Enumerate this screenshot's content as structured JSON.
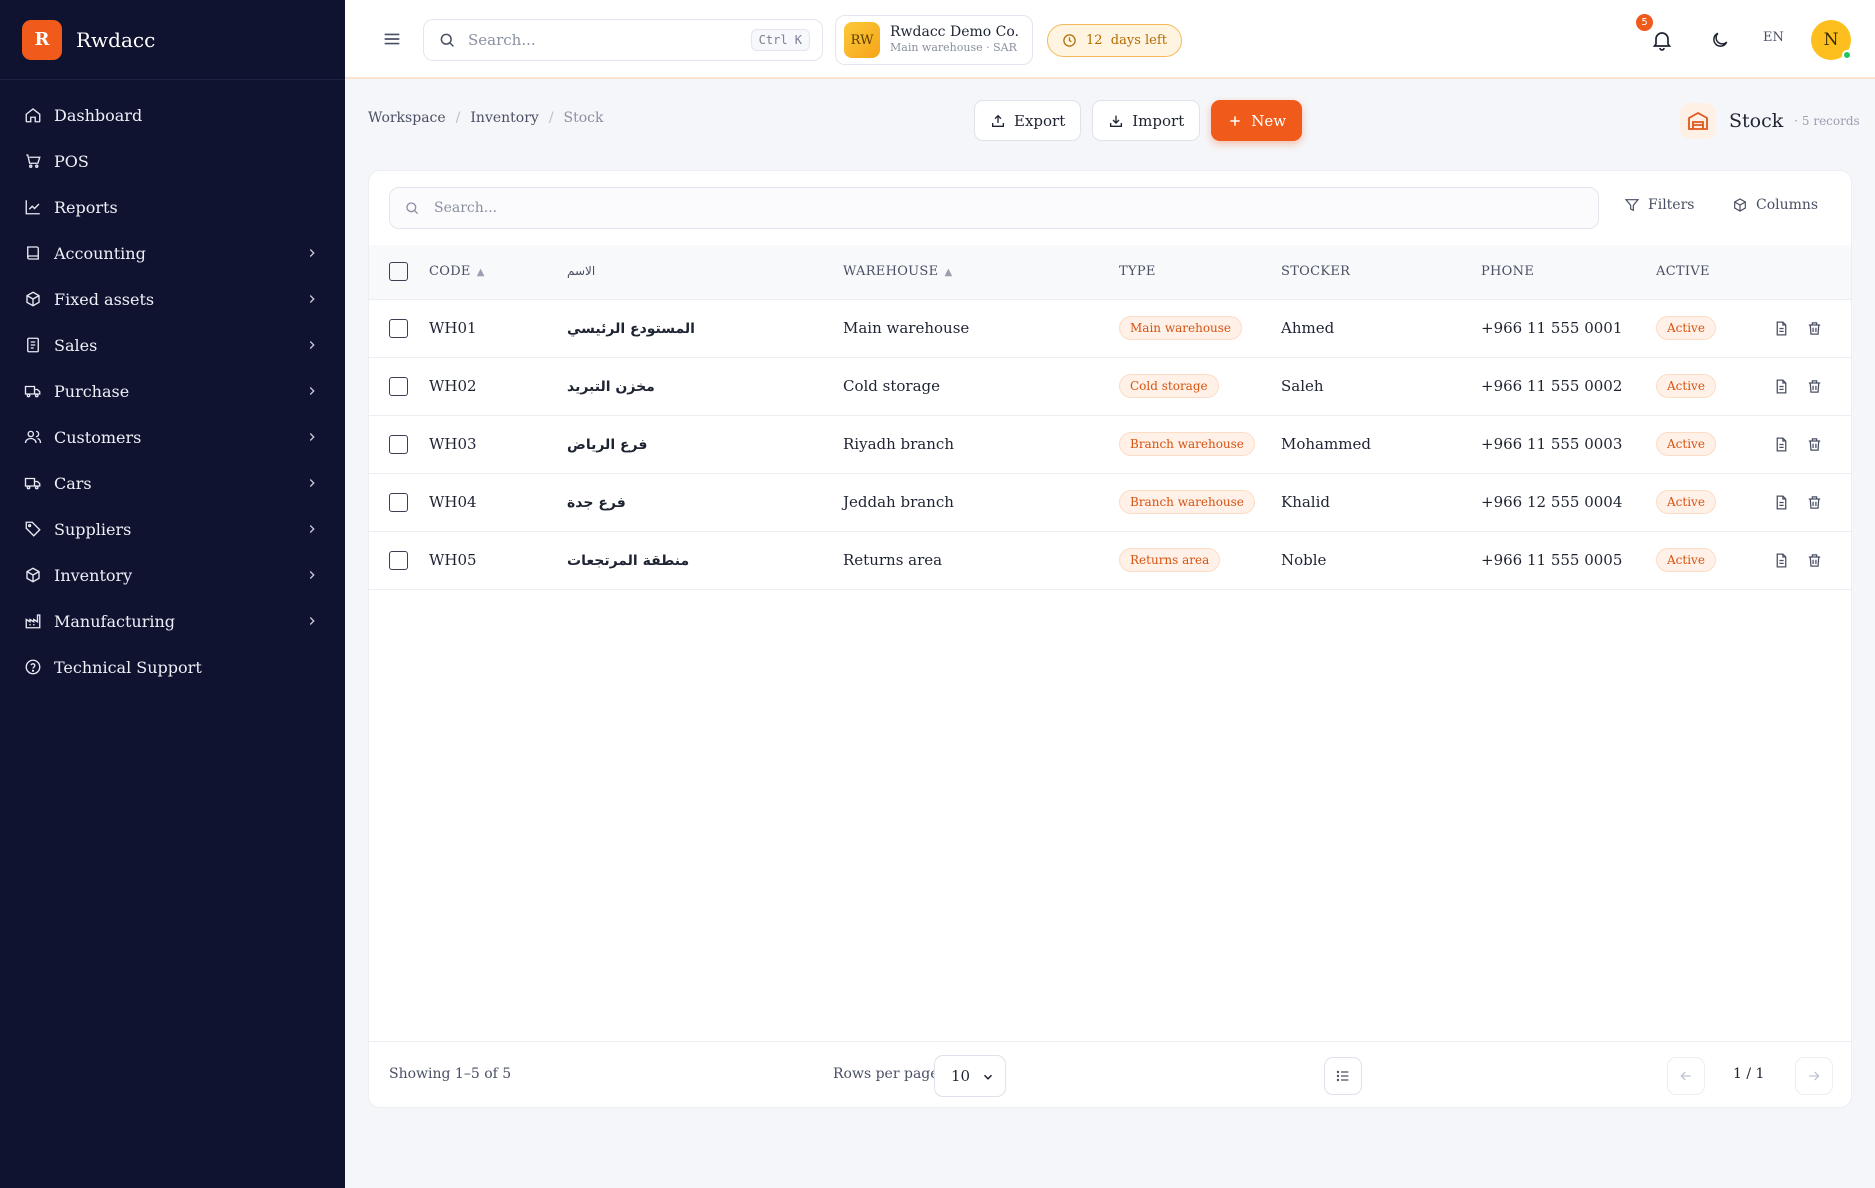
{
  "brand": {
    "logo_letter": "R",
    "name": "Rwdacc"
  },
  "sidebar": {
    "items": [
      {
        "label": "Dashboard",
        "icon": "home-icon",
        "has_children": false
      },
      {
        "label": "POS",
        "icon": "cart-icon",
        "has_children": false
      },
      {
        "label": "Reports",
        "icon": "chart-line-icon",
        "has_children": false
      },
      {
        "label": "Accounting",
        "icon": "book-icon",
        "has_children": true
      },
      {
        "label": "Fixed assets",
        "icon": "box-icon",
        "has_children": true
      },
      {
        "label": "Sales",
        "icon": "receipt-icon",
        "has_children": true
      },
      {
        "label": "Purchase",
        "icon": "truck-icon",
        "has_children": true
      },
      {
        "label": "Customers",
        "icon": "users-icon",
        "has_children": true
      },
      {
        "label": "Cars",
        "icon": "car-truck-icon",
        "has_children": true
      },
      {
        "label": "Suppliers",
        "icon": "tag-icon",
        "has_children": true
      },
      {
        "label": "Inventory",
        "icon": "package-icon",
        "has_children": true
      },
      {
        "label": "Manufacturing",
        "icon": "factory-icon",
        "has_children": true
      },
      {
        "label": "Technical Support",
        "icon": "help-circle-icon",
        "has_children": false
      }
    ]
  },
  "topbar": {
    "search_placeholder": "Search...",
    "search_shortcut": "Ctrl K",
    "company": {
      "initials": "RW",
      "name": "Rwdacc Demo Co.",
      "subtitle": "Main warehouse · SAR"
    },
    "trial": "12  days left",
    "notifications_count": "5",
    "language": "EN",
    "user_initial": "N"
  },
  "breadcrumb": {
    "items": [
      "Workspace",
      "Inventory"
    ],
    "current": "Stock"
  },
  "actions": {
    "export": "Export",
    "import": "Import",
    "new": "New"
  },
  "page": {
    "title": "Stock",
    "records": "· 5 records"
  },
  "table_toolbar": {
    "search_placeholder": "Search...",
    "filters": "Filters",
    "columns": "Columns"
  },
  "table": {
    "headers": {
      "code": "CODE",
      "name": "الاسم",
      "warehouse": "WAREHOUSE",
      "type": "TYPE",
      "stocker": "STOCKER",
      "phone": "PHONE",
      "active": "ACTIVE"
    },
    "rows": [
      {
        "code": "WH01",
        "name": "المستودع الرئيسي",
        "warehouse": "Main warehouse",
        "type": "Main warehouse",
        "stocker": "Ahmed",
        "phone": "+966 11 555 0001",
        "active": "Active"
      },
      {
        "code": "WH02",
        "name": "مخزن التبريد",
        "warehouse": "Cold storage",
        "type": "Cold storage",
        "stocker": "Saleh",
        "phone": "+966 11 555 0002",
        "active": "Active"
      },
      {
        "code": "WH03",
        "name": "فرع الرياض",
        "warehouse": "Riyadh branch",
        "type": "Branch warehouse",
        "stocker": "Mohammed",
        "phone": "+966 11 555 0003",
        "active": "Active"
      },
      {
        "code": "WH04",
        "name": "فرع جدة",
        "warehouse": "Jeddah branch",
        "type": "Branch warehouse",
        "stocker": "Khalid",
        "phone": "+966 12 555 0004",
        "active": "Active"
      },
      {
        "code": "WH05",
        "name": "منطقة المرتجعات",
        "warehouse": "Returns area",
        "type": "Returns area",
        "stocker": "Noble",
        "phone": "+966 11 555 0005",
        "active": "Active"
      }
    ]
  },
  "footer": {
    "showing": "Showing 1–5 of 5",
    "rows_per_page_label": "Rows per page",
    "rows_per_page": "10",
    "page_info": "1 / 1"
  },
  "colors": {
    "sidebar_bg": "#0f1330",
    "accent": "#f05a1a",
    "trial_bg": "#fff4e0"
  }
}
